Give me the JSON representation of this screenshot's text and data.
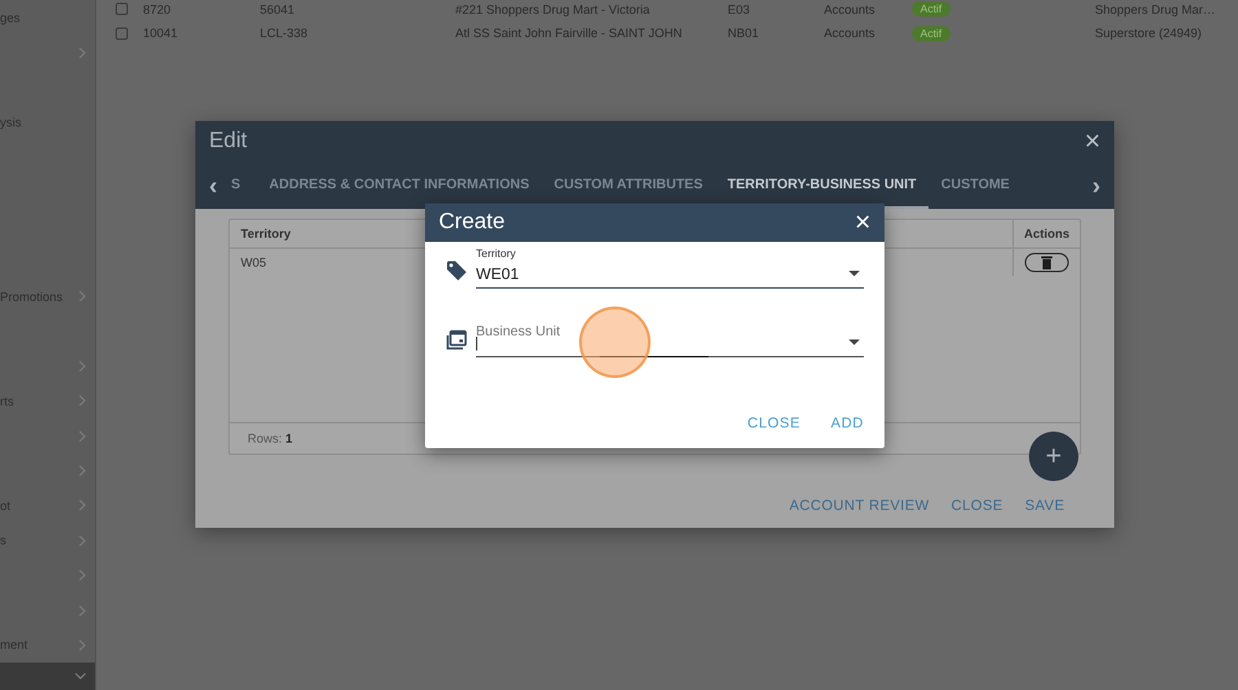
{
  "sidebar": {
    "items": [
      {
        "label": "ges",
        "chevron": false,
        "selected": false
      },
      {
        "chevron": true,
        "selected": false
      },
      {
        "chevron": false,
        "selected": false
      },
      {
        "label": "ysis",
        "chevron": false,
        "selected": false
      },
      {
        "chevron": false,
        "selected": false
      },
      {
        "chevron": false,
        "selected": false
      },
      {
        "chevron": false,
        "selected": false
      },
      {
        "chevron": false,
        "selected": false
      },
      {
        "label": "Promotions",
        "chevron": true,
        "selected": false
      },
      {
        "chevron": false,
        "selected": false
      },
      {
        "chevron": true,
        "selected": false
      },
      {
        "label": "rts",
        "chevron": true,
        "selected": false
      },
      {
        "chevron": true,
        "selected": false
      },
      {
        "chevron": true,
        "selected": false
      },
      {
        "label": "ot",
        "chevron": true,
        "selected": false
      },
      {
        "label": "s",
        "chevron": true,
        "selected": false
      },
      {
        "chevron": true,
        "selected": false
      },
      {
        "chevron": true,
        "selected": false
      },
      {
        "label": "ment",
        "chevron": true,
        "selected": false
      },
      {
        "chevron": true,
        "selected": true
      }
    ]
  },
  "accounts_table": {
    "rows": [
      {
        "checked": false,
        "cells": [
          "8720",
          "56041",
          "#221 Shoppers Drug Mart - Victoria",
          "E03",
          "Accounts"
        ],
        "status": "Actif",
        "store": "Shoppers Drug Mar…"
      },
      {
        "checked": false,
        "cells": [
          "10041",
          "LCL-338",
          "Atl SS Saint John Fairville - SAINT JOHN",
          "NB01",
          "Accounts"
        ],
        "status": "Actif",
        "store": "Superstore (24949)"
      }
    ]
  },
  "edit_dialog": {
    "title": "Edit",
    "close": "×",
    "tab_prev": "‹",
    "tab_next": "›",
    "tabs": [
      {
        "label": "S",
        "selected": false
      },
      {
        "label": "ADDRESS & CONTACT INFORMATIONS",
        "selected": false
      },
      {
        "label": "CUSTOM ATTRIBUTES",
        "selected": false
      },
      {
        "label": "TERRITORY-BUSINESS UNIT",
        "selected": true
      },
      {
        "label": "CUSTOME",
        "selected": false
      }
    ],
    "table": {
      "columns": [
        "Territory",
        "Actions"
      ],
      "rows": [
        {
          "territory": "W05"
        }
      ],
      "footer": "Rows: **1**"
    },
    "fab": "+",
    "buttons": [
      "ACCOUNT REVIEW",
      "CLOSE",
      "SAVE"
    ]
  },
  "create_dialog": {
    "title": "Create",
    "close": "×",
    "fields": [
      {
        "label": "Territory",
        "value": "WE01",
        "focused": false
      },
      {
        "placeholder": "Business Unit",
        "focused": true
      }
    ],
    "buttons": [
      "CLOSE",
      "ADD"
    ]
  }
}
